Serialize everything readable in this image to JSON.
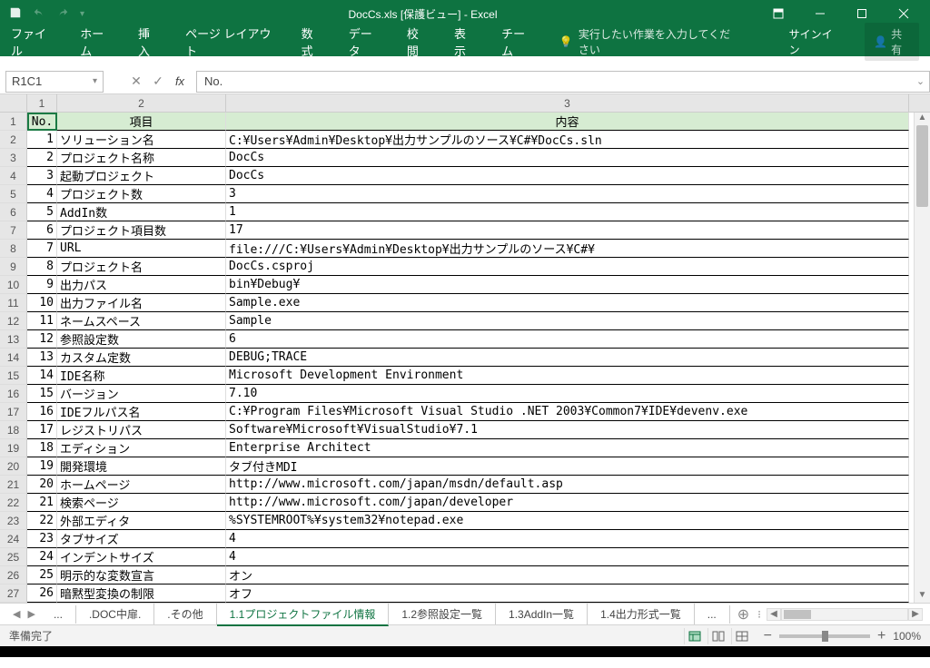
{
  "titlebar": {
    "title": "DocCs.xls  [保護ビュー] - Excel"
  },
  "ribbon": {
    "file": "ファイル",
    "home": "ホーム",
    "insert": "挿入",
    "pagelayout": "ページ レイアウト",
    "formulas": "数式",
    "data": "データ",
    "review": "校閲",
    "view": "表示",
    "team": "チーム",
    "tellme": "実行したい作業を入力してください",
    "signin": "サインイン",
    "share": "共有"
  },
  "formula_bar": {
    "name_box": "R1C1",
    "formula": "No."
  },
  "col_headers": [
    "1",
    "2",
    "3"
  ],
  "header_row": {
    "c1": "No.",
    "c2": "項目",
    "c3": "内容"
  },
  "rows": [
    {
      "n": "1",
      "item": "ソリューション名",
      "val": "C:\\Users\\Admin\\Desktop\\出力サンプルのソース\\C#\\DocCs.sln"
    },
    {
      "n": "2",
      "item": "プロジェクト名称",
      "val": "DocCs"
    },
    {
      "n": "3",
      "item": "起動プロジェクト",
      "val": "DocCs"
    },
    {
      "n": "4",
      "item": "プロジェクト数",
      "val": "3"
    },
    {
      "n": "5",
      "item": "AddIn数",
      "val": "1"
    },
    {
      "n": "6",
      "item": "プロジェクト項目数",
      "val": "17"
    },
    {
      "n": "7",
      "item": "URL",
      "val": "file:///C:\\Users\\Admin\\Desktop\\出力サンプルのソース\\C#\\"
    },
    {
      "n": "8",
      "item": "プロジェクト名",
      "val": "DocCs.csproj"
    },
    {
      "n": "9",
      "item": "出力パス",
      "val": "bin\\Debug\\"
    },
    {
      "n": "10",
      "item": "出力ファイル名",
      "val": "Sample.exe"
    },
    {
      "n": "11",
      "item": "ネームスペース",
      "val": "Sample"
    },
    {
      "n": "12",
      "item": "参照設定数",
      "val": "6"
    },
    {
      "n": "13",
      "item": "カスタム定数",
      "val": "DEBUG;TRACE"
    },
    {
      "n": "14",
      "item": "IDE名称",
      "val": "Microsoft Development Environment"
    },
    {
      "n": "15",
      "item": "バージョン",
      "val": "7.10"
    },
    {
      "n": "16",
      "item": "IDEフルパス名",
      "val": "C:\\Program Files\\Microsoft Visual Studio .NET 2003\\Common7\\IDE\\devenv.exe"
    },
    {
      "n": "17",
      "item": "レジストリパス",
      "val": "Software\\Microsoft\\VisualStudio\\7.1"
    },
    {
      "n": "18",
      "item": "エディション",
      "val": "Enterprise Architect"
    },
    {
      "n": "19",
      "item": "開発環境",
      "val": "タブ付きMDI"
    },
    {
      "n": "20",
      "item": "ホームページ",
      "val": "http://www.microsoft.com/japan/msdn/default.asp"
    },
    {
      "n": "21",
      "item": "検索ページ",
      "val": "http://www.microsoft.com/japan/developer"
    },
    {
      "n": "22",
      "item": "外部エディタ",
      "val": "%SYSTEMROOT%\\system32\\notepad.exe"
    },
    {
      "n": "23",
      "item": "タブサイズ",
      "val": "4"
    },
    {
      "n": "24",
      "item": "インデントサイズ",
      "val": "4"
    },
    {
      "n": "25",
      "item": "明示的な変数宣言",
      "val": "オン"
    },
    {
      "n": "26",
      "item": "暗黙型変換の制限",
      "val": "オフ"
    }
  ],
  "sheet_tabs": {
    "overflow_left": "...",
    "t1": ".DOC中扉.",
    "t2": ".その他",
    "t3": "1.1プロジェクトファイル情報",
    "t4": "1.2参照設定一覧",
    "t5": "1.3AddIn一覧",
    "t6": "1.4出力形式一覧",
    "overflow_right": "..."
  },
  "status": {
    "ready": "準備完了",
    "zoom": "100%"
  }
}
